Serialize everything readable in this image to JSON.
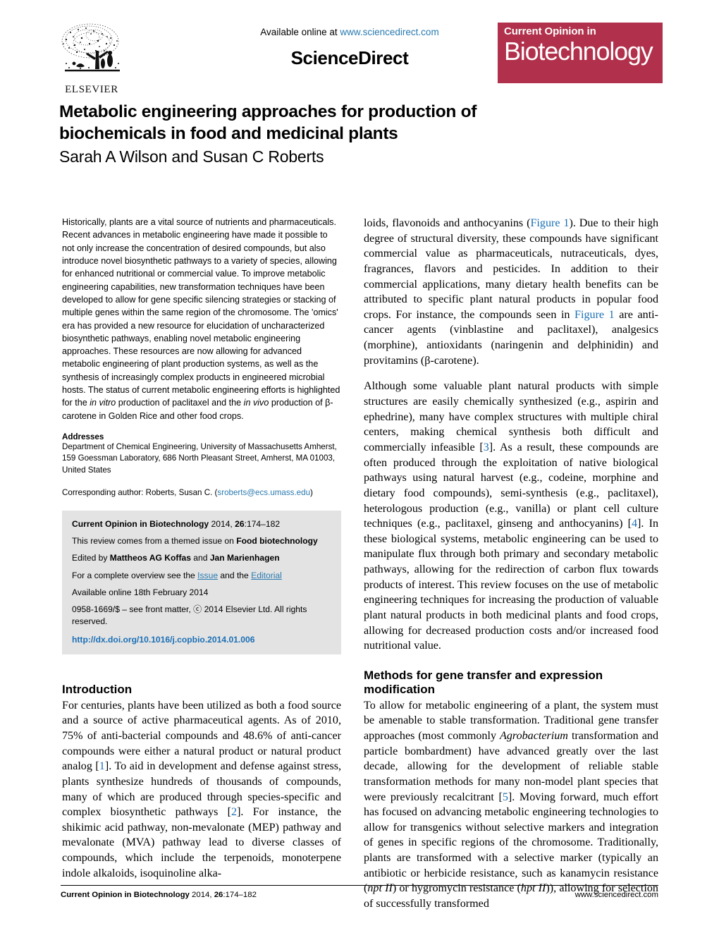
{
  "masthead": {
    "available_prefix": "Available online at ",
    "sciencedirect_url": "www.sciencedirect.com",
    "sciencedirect_wordmark": "ScienceDirect",
    "elsevier_wordmark": "ELSEVIER",
    "journal_logo_line1": "Current Opinion in",
    "journal_logo_line2": "Biotechnology",
    "journal_logo_color": "#b1304b"
  },
  "title": {
    "line1": "Metabolic engineering approaches for production of",
    "line2": "biochemicals in food and medicinal plants",
    "authors": "Sarah A Wilson and Susan C Roberts"
  },
  "abstract": {
    "text": "Historically, plants are a vital source of nutrients and pharmaceuticals. Recent advances in metabolic engineering have made it possible to not only increase the concentration of desired compounds, but also introduce novel biosynthetic pathways to a variety of species, allowing for enhanced nutritional or commercial value. To improve metabolic engineering capabilities, new transformation techniques have been developed to allow for gene specific silencing strategies or stacking of multiple genes within the same region of the chromosome. The 'omics' era has provided a new resource for elucidation of uncharacterized biosynthetic pathways, enabling novel metabolic engineering approaches. These resources are now allowing for advanced metabolic engineering of plant production systems, as well as the synthesis of increasingly complex products in engineered microbial hosts. The status of current metabolic engineering efforts is highlighted for the ",
    "italic1": "in vitro",
    "text2": " production of paclitaxel and the ",
    "italic2": "in vivo",
    "text3": " production of β-carotene in Golden Rice and other food crops."
  },
  "addresses": {
    "heading": "Addresses",
    "text": "Department of Chemical Engineering, University of Massachusetts Amherst, 159 Goessman Laboratory, 686 North Pleasant Street, Amherst, MA 01003, United States",
    "corresponding_prefix": "Corresponding author: Roberts, Susan C. (",
    "corresponding_email": "sroberts@ecs.umass.edu",
    "corresponding_suffix": ")"
  },
  "infobox": {
    "citation_journal": "Current Opinion in Biotechnology",
    "citation_rest_1": " 2014, ",
    "citation_volume": "26",
    "citation_rest_2": ":174–182",
    "themed_prefix": "This review comes from a themed issue on ",
    "themed_topic": "Food biotechnology",
    "edited_prefix": "Edited by ",
    "editor1": "Mattheos AG Koffas",
    "edited_mid": " and ",
    "editor2": "Jan Marienhagen",
    "overview_prefix": "For a complete overview see the ",
    "overview_link1": "Issue",
    "overview_mid": " and the ",
    "overview_link2": "Editorial",
    "available_online": "Available online 18th February 2014",
    "front_matter": "0958-1669/$ – see front matter, ⓒ 2014 Elsevier Ltd. All rights reserved.",
    "doi": "http://dx.doi.org/10.1016/j.copbio.2014.01.006"
  },
  "sections": {
    "introduction_heading": "Introduction",
    "methods_heading_line1": "Methods for gene transfer and expression",
    "methods_heading_line2": "modification"
  },
  "body": {
    "intro_p1_a": "For centuries, plants have been utilized as both a food source and a source of active pharmaceutical agents. As of 2010, 75% of anti-bacterial compounds and 48.6% of anti-cancer compounds were either a natural product or natural product analog [",
    "intro_ref1": "1",
    "intro_p1_b": "]. To aid in development and defense against stress, plants synthesize hundreds of thousands of compounds, many of which are produced through species-specific and complex biosynthetic pathways [",
    "intro_ref2": "2",
    "intro_p1_c": "]. For instance, the shikimic acid pathway, non-mevalonate (MEP) pathway and mevalonate (MVA) pathway lead to diverse classes of compounds, which include the terpenoids, monoterpene indole alkaloids, isoquinoline alka-",
    "right_p1_a": "loids, flavonoids and anthocyanins (",
    "right_figref1": "Figure 1",
    "right_p1_b": "). Due to their high degree of structural diversity, these compounds have significant commercial value as pharmaceuticals, nutraceuticals, dyes, fragrances, flavors and pesticides. In addition to their commercial applications, many dietary health benefits can be attributed to specific plant natural products in popular food crops. For instance, the compounds seen in ",
    "right_figref2": "Figure 1",
    "right_p1_c": " are anti-cancer agents (vinblastine and paclitaxel), analgesics (morphine), antioxidants (naringenin and delphinidin) and provitamins (β-carotene).",
    "right_p2_a": "Although some valuable plant natural products with simple structures are easily chemically synthesized (e.g., aspirin and ephedrine), many have complex structures with multiple chiral centers, making chemical synthesis both difficult and commercially infeasible [",
    "right_ref3": "3",
    "right_p2_b": "]. As a result, these compounds are often produced through the exploitation of native biological pathways using natural harvest (e.g., codeine, morphine and dietary food compounds), semi-synthesis (e.g., paclitaxel), heterologous production (e.g., vanilla) or plant cell culture techniques (e.g., paclitaxel, ginseng and anthocyanins) [",
    "right_ref4": "4",
    "right_p2_c": "]. In these biological systems, metabolic engineering can be used to manipulate flux through both primary and secondary metabolic pathways, allowing for the redirection of carbon flux towards products of interest. This review focuses on the use of metabolic engineering techniques for increasing the production of valuable plant natural products in both medicinal plants and food crops, allowing for decreased production costs and/or increased food nutritional value.",
    "methods_p1_a": "To allow for metabolic engineering of a plant, the system must be amenable to stable transformation. Traditional gene transfer approaches (most commonly ",
    "methods_italic1": "Agrobacterium",
    "methods_p1_b": " transformation and particle bombardment) have advanced greatly over the last decade, allowing for the development of reliable stable transformation methods for many non-model plant species that were previously recalcitrant [",
    "methods_ref5": "5",
    "methods_p1_c": "]. Moving forward, much effort has focused on advancing metabolic engineering technologies to allow for transgenics without selective markers and integration of genes in specific regions of the chromosome. Traditionally, plants are transformed with a selective marker (typically an antibiotic or herbicide resistance, such as kanamycin resistance (",
    "methods_italic2": "npt II",
    "methods_p1_d": ") or hygromycin resistance (",
    "methods_italic3": "hpt II",
    "methods_p1_e": ")), allowing for selection of successfully transformed"
  },
  "footer": {
    "left_journal": "Current Opinion in Biotechnology",
    "left_rest": " 2014, ",
    "left_volume": "26",
    "left_pages": ":174–182",
    "right": "www.sciencedirect.com"
  }
}
